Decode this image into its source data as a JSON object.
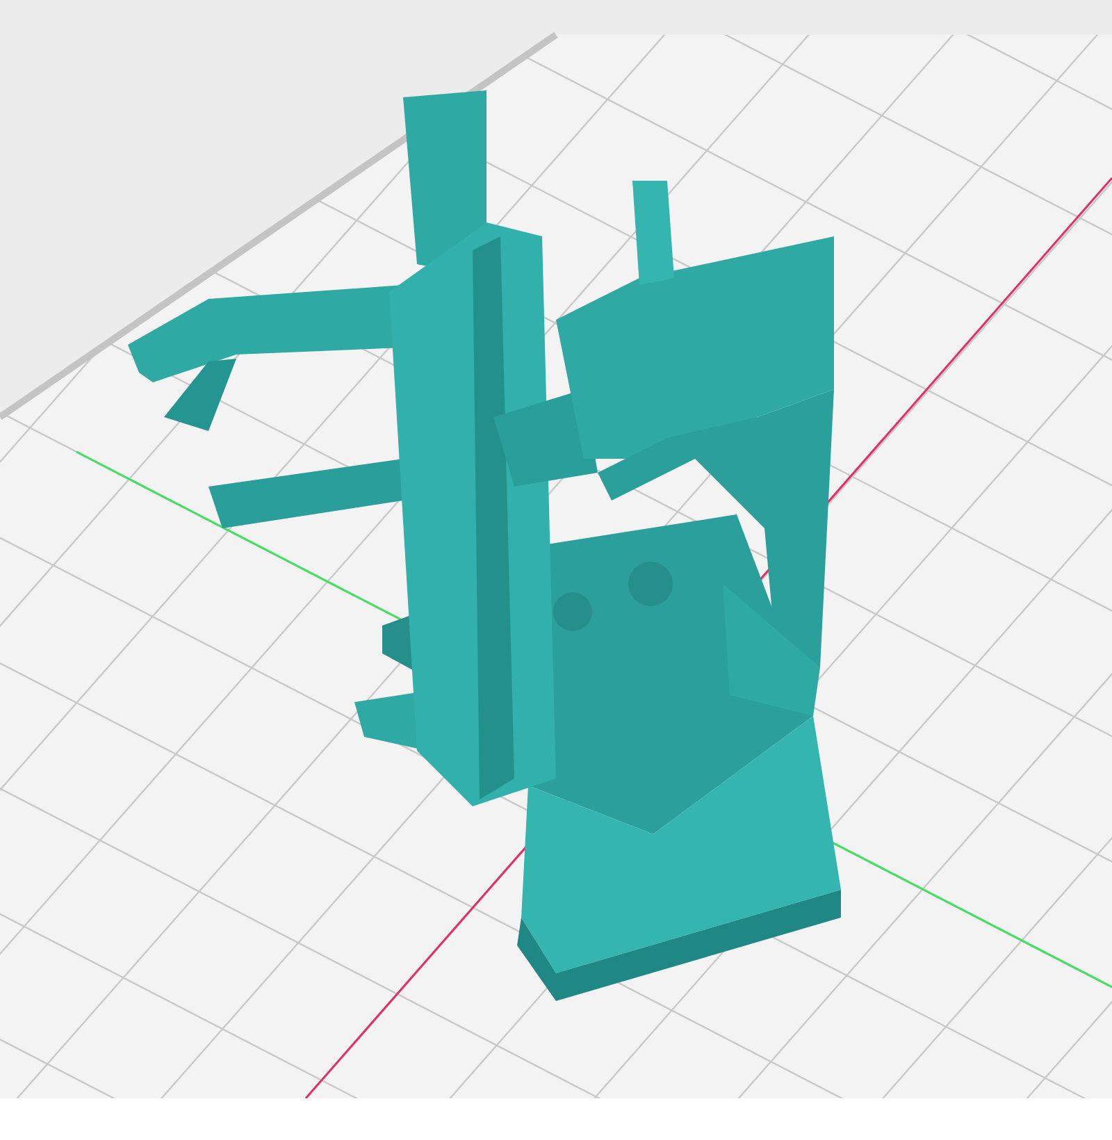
{
  "viewport": {
    "axes": [
      {
        "kind": "x",
        "color": "#e0306a"
      },
      {
        "kind": "y",
        "color": "#40e060"
      }
    ]
  }
}
